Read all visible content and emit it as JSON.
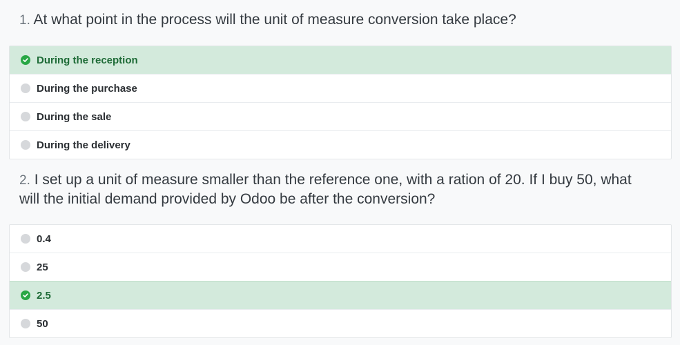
{
  "questions": [
    {
      "number": "1.",
      "text": "At what point in the process will the unit of measure conversion take place?",
      "answers": [
        {
          "label": "During the reception",
          "correct": true
        },
        {
          "label": "During the purchase",
          "correct": false
        },
        {
          "label": "During the sale",
          "correct": false
        },
        {
          "label": "During the delivery",
          "correct": false
        }
      ]
    },
    {
      "number": "2.",
      "text": "I set up a unit of measure smaller than the reference one, with a ration of 20. If I buy 50, what will the initial demand provided by Odoo be after the conversion?",
      "answers": [
        {
          "label": "0.4",
          "correct": false
        },
        {
          "label": "25",
          "correct": false
        },
        {
          "label": "2.5",
          "correct": true
        },
        {
          "label": "50",
          "correct": false
        }
      ]
    }
  ],
  "colors": {
    "correct_bg": "#d3eadc",
    "correct_text": "#1e6b37",
    "correct_icon": "#28a745",
    "neutral_marker": "#d6d8db"
  },
  "icons": {
    "correct": "check-circle-icon",
    "neutral": "radio-circle-icon"
  }
}
